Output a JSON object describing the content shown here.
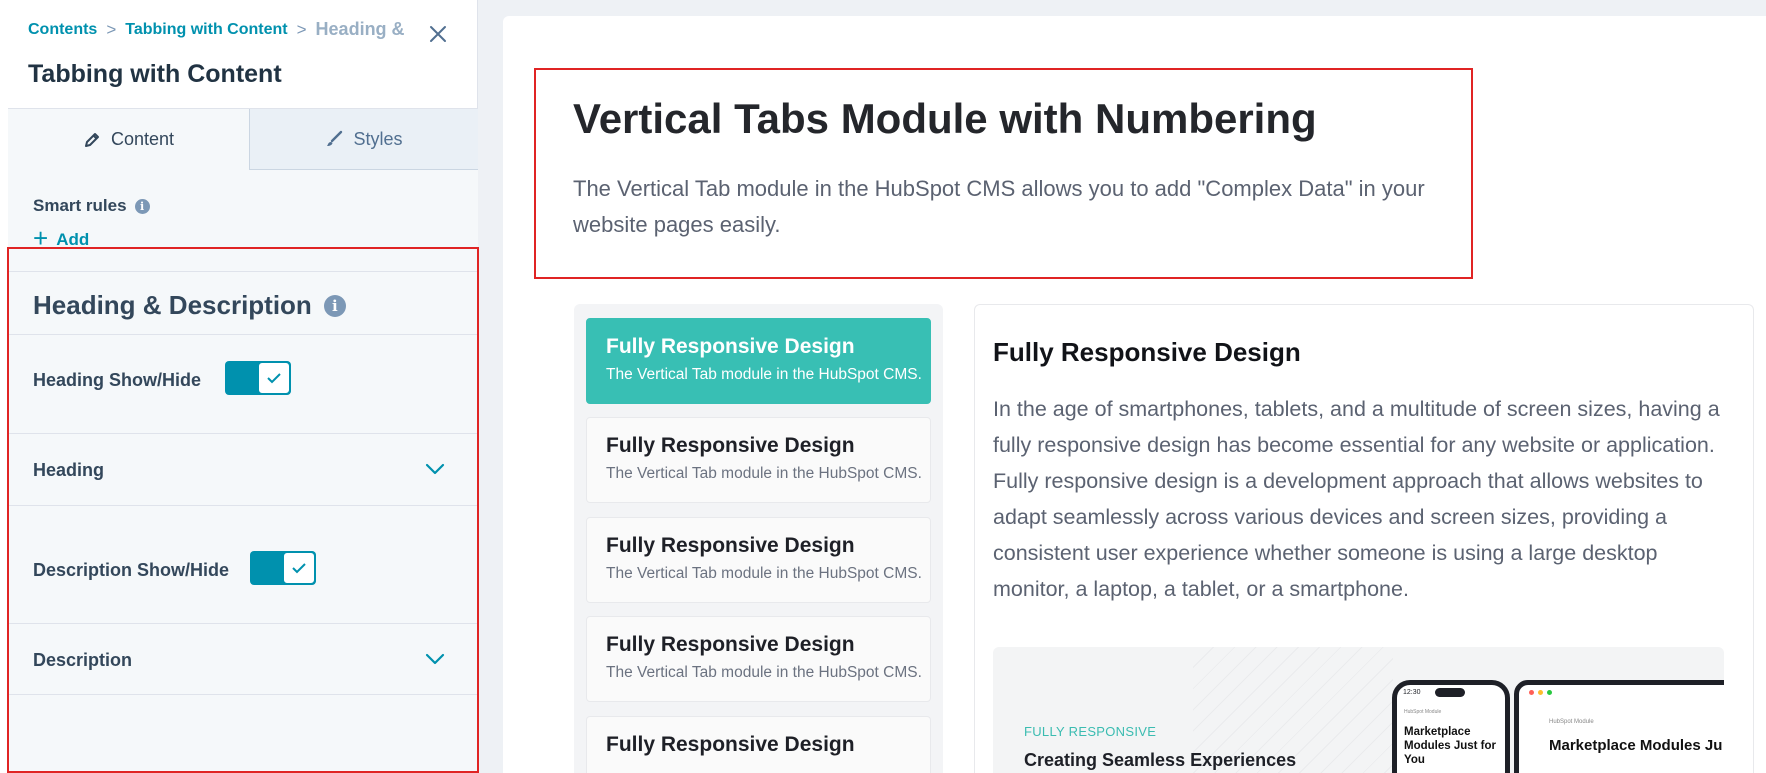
{
  "breadcrumb": {
    "items": [
      "Contents",
      "Tabbing with Content"
    ],
    "current": "Heading &",
    "separator": ">"
  },
  "panel": {
    "title": "Tabbing with Content",
    "tabs": [
      {
        "label": "Content",
        "icon": "pencil-icon",
        "active": true
      },
      {
        "label": "Styles",
        "icon": "brush-icon",
        "active": false
      }
    ],
    "smart_rules": {
      "label": "Smart rules",
      "add_label": "Add"
    },
    "section": {
      "title": "Heading & Description",
      "fields": {
        "heading_toggle": {
          "label": "Heading Show/Hide",
          "on": true
        },
        "heading": {
          "label": "Heading"
        },
        "description_toggle": {
          "label": "Description Show/Hide",
          "on": true
        },
        "description": {
          "label": "Description"
        }
      }
    }
  },
  "preview": {
    "hero": {
      "title": "Vertical Tabs Module with Numbering",
      "description": "The Vertical Tab module in the HubSpot CMS allows you to add \"Complex Data\" in your website pages easily."
    },
    "tabs": [
      {
        "title": "Fully Responsive Design",
        "desc": "The Vertical Tab module in the HubSpot CMS.",
        "active": true
      },
      {
        "title": "Fully Responsive Design",
        "desc": "The Vertical Tab module in the HubSpot CMS.",
        "active": false
      },
      {
        "title": "Fully Responsive Design",
        "desc": "The Vertical Tab module in the HubSpot CMS.",
        "active": false
      },
      {
        "title": "Fully Responsive Design",
        "desc": "The Vertical Tab module in the HubSpot CMS.",
        "active": false
      },
      {
        "title": "Fully Responsive Design",
        "desc": "",
        "active": false
      }
    ],
    "detail": {
      "title": "Fully Responsive Design",
      "text": "In the age of smartphones, tablets, and a multitude of screen sizes, having a fully responsive design has become essential for any website or application. Fully responsive design is a development approach that allows websites to adapt seamlessly across various devices and screen sizes, providing a consistent user experience whether someone is using a large desktop monitor, a laptop, a tablet, or a smartphone.",
      "media": {
        "kicker": "FULLY RESPONSIVE",
        "heading": "Creating Seamless Experiences",
        "phone": {
          "time": "12:30",
          "mini_label": "HubSpot Module",
          "heading": "Marketplace Modules Just for You"
        },
        "tablet": {
          "mini_label": "HubSpot Module",
          "heading": "Marketplace Modules Ju"
        }
      }
    }
  },
  "colors": {
    "accent": "#0091ae",
    "tab_active": "#38bfb4",
    "highlight": "#e02424",
    "heading_dark": "#213343"
  }
}
